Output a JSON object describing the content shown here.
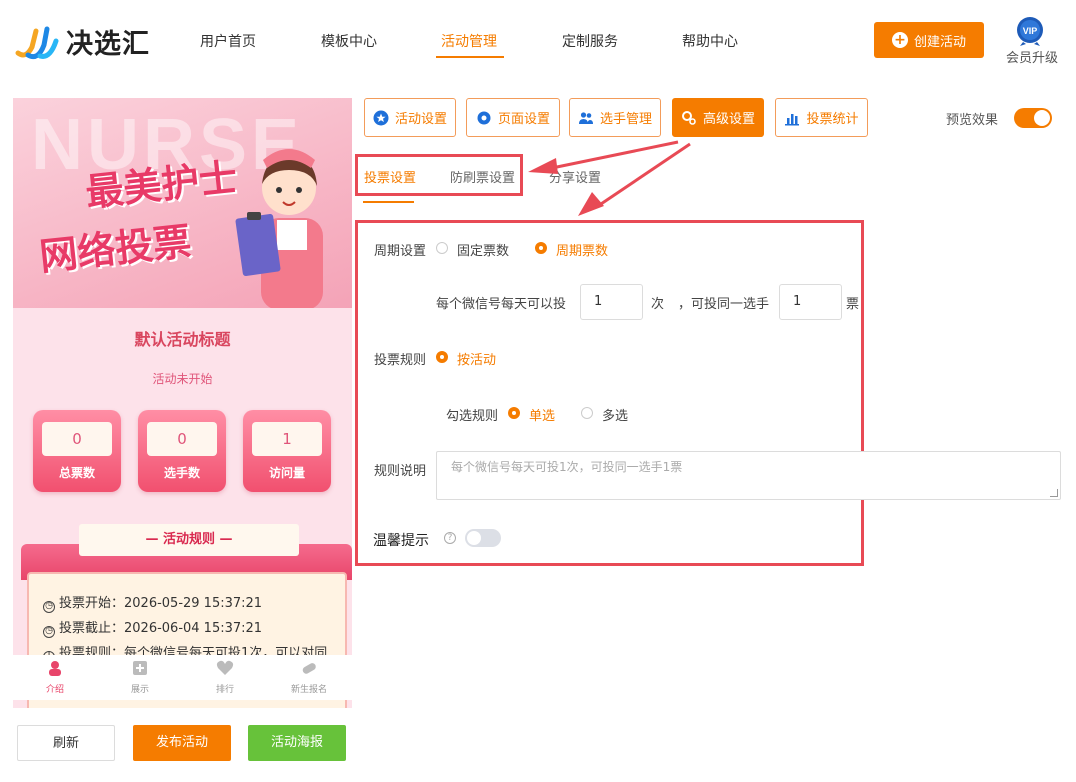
{
  "brand": {
    "name": "决选汇"
  },
  "nav": {
    "items": [
      {
        "label": "用户首页"
      },
      {
        "label": "模板中心"
      },
      {
        "label": "活动管理"
      },
      {
        "label": "定制服务"
      },
      {
        "label": "帮助中心"
      }
    ],
    "active": "活动管理"
  },
  "header": {
    "create_label": "创建活动",
    "vip_badge": "VIP",
    "vip_label": "会员升级"
  },
  "preview": {
    "banner_bg_text": "NURSE",
    "banner_title_1": "最美护士",
    "banner_title_2": "网络投票",
    "title": "默认活动标题",
    "status": "活动未开始",
    "stats": [
      {
        "value": "0",
        "label": "总票数"
      },
      {
        "value": "0",
        "label": "选手数"
      },
      {
        "value": "1",
        "label": "访问量"
      }
    ],
    "rules_title": "— 活动规则 —",
    "rules": [
      {
        "icon": "clock-icon",
        "text": "投票开始：2026-05-29 15:37:21"
      },
      {
        "icon": "clock-icon",
        "text": "投票截止：2026-06-04 15:37:21"
      },
      {
        "icon": "info-icon",
        "text": "投票规则：每个微信号每天可投1次，可以对同"
      }
    ],
    "tabbar": [
      {
        "label": "介绍",
        "icon": "nurse-icon"
      },
      {
        "label": "展示",
        "icon": "gallery-icon"
      },
      {
        "label": "排行",
        "icon": "heart-icon"
      },
      {
        "label": "新生报名",
        "icon": "pill-icon"
      }
    ]
  },
  "bottom_buttons": {
    "refresh": "刷新",
    "publish": "发布活动",
    "poster": "活动海报"
  },
  "settings_tabs": [
    {
      "label": "活动设置",
      "icon": "star-icon"
    },
    {
      "label": "页面设置",
      "icon": "gear-icon"
    },
    {
      "label": "选手管理",
      "icon": "users-icon"
    },
    {
      "label": "高级设置",
      "icon": "advanced-gear-icon"
    },
    {
      "label": "投票统计",
      "icon": "bar-chart-icon"
    }
  ],
  "active_settings_tab": "高级设置",
  "preview_toggle": {
    "label": "预览效果",
    "on": true
  },
  "sub_tabs": [
    {
      "label": "投票设置"
    },
    {
      "label": "防刷票设置"
    },
    {
      "label": "分享设置"
    }
  ],
  "active_sub_tab": "投票设置",
  "form": {
    "period_label": "周期设置",
    "period_options": [
      {
        "label": "固定票数",
        "selected": false
      },
      {
        "label": "周期票数",
        "selected": true
      }
    ],
    "daily_prefix": "每个微信号每天可以投",
    "daily_value": "1",
    "daily_unit": "次",
    "same_player_prefix": "，可投同一选手",
    "same_player_value": "1",
    "same_player_unit": "票",
    "vote_rule_label": "投票规则",
    "vote_rule_option": "按活动",
    "check_rule_label": "勾选规则",
    "check_options": [
      {
        "label": "单选",
        "selected": true
      },
      {
        "label": "多选",
        "selected": false
      }
    ],
    "rule_desc_label": "规则说明",
    "rule_desc_placeholder": "每个微信号每天可投1次，可投同一选手1票",
    "tip_label": "温馨提示",
    "tip_help": "?",
    "tip_enabled": false
  },
  "colors": {
    "accent": "#f57c00",
    "annotation_red": "#e84a55",
    "green": "#67c23a",
    "pink": "#e8456a"
  }
}
